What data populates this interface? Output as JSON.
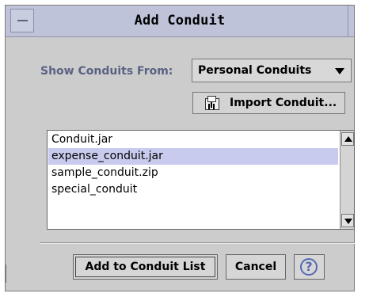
{
  "window": {
    "title": "Add Conduit"
  },
  "filter": {
    "label": "Show Conduits From:",
    "selected": "Personal Conduits"
  },
  "actions": {
    "import_label": "Import Conduit...",
    "add_label": "Add to Conduit List",
    "cancel_label": "Cancel",
    "help_label": "?"
  },
  "conduits": {
    "items": [
      "Conduit.jar",
      "expense_conduit.jar",
      "sample_conduit.zip",
      "special_conduit"
    ],
    "selected_index": 1
  },
  "icons": {
    "menu": "window-menu-icon",
    "dropdown": "dropdown-arrow-icon",
    "import": "import-icon",
    "scroll_up": "up-arrow-icon",
    "scroll_down": "down-arrow-icon",
    "help": "help-icon"
  },
  "colors": {
    "window_bg": "#cccccc",
    "title_bg": "#bfc3d9",
    "label_text": "#5a6283",
    "selection_bg": "#c8cbed",
    "help_accent": "#566bb1"
  }
}
